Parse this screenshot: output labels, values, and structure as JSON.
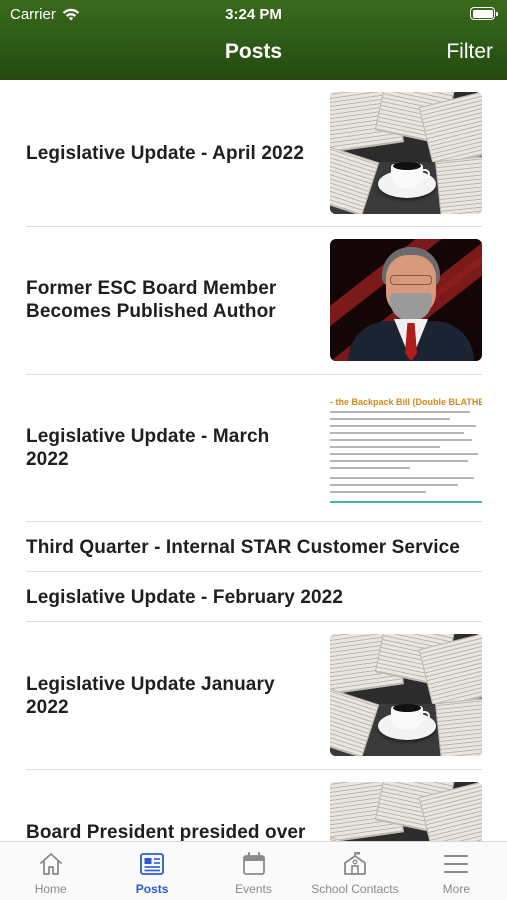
{
  "status_bar": {
    "carrier": "Carrier",
    "time": "3:24 PM"
  },
  "nav": {
    "title": "Posts",
    "filter_label": "Filter"
  },
  "posts": [
    {
      "title": "Legislative Update - April 2022",
      "thumbnail": "newspaper-coffee"
    },
    {
      "title": "Former ESC Board Member Becomes Published Author",
      "thumbnail": "author-portrait"
    },
    {
      "title": "Legislative Update - March 2022",
      "thumbnail": "document-page",
      "thumbnail_heading": "- the Backpack Bill (Double BLATHER)"
    },
    {
      "title": "Third Quarter - Internal STAR Customer Service"
    },
    {
      "title": "Legislative Update - February 2022"
    },
    {
      "title": "Legislative Update January 2022",
      "thumbnail": "newspaper-coffee"
    },
    {
      "title": "Board President presided over",
      "thumbnail": "newspaper-coffee"
    }
  ],
  "tab_bar": {
    "tabs": [
      {
        "label": "Home",
        "icon": "home-icon",
        "active": false
      },
      {
        "label": "Posts",
        "icon": "posts-icon",
        "active": true
      },
      {
        "label": "Events",
        "icon": "calendar-icon",
        "active": false
      },
      {
        "label": "School Contacts",
        "icon": "school-icon",
        "active": false
      },
      {
        "label": "More",
        "icon": "menu-icon",
        "active": false
      }
    ]
  },
  "colors": {
    "header_green": "#2c5816",
    "active_tab": "#2a5bd7",
    "inactive_tab": "#8a8a8a",
    "doc_heading_orange": "#d2881e",
    "doc_heading_teal": "#2b8fa8"
  }
}
